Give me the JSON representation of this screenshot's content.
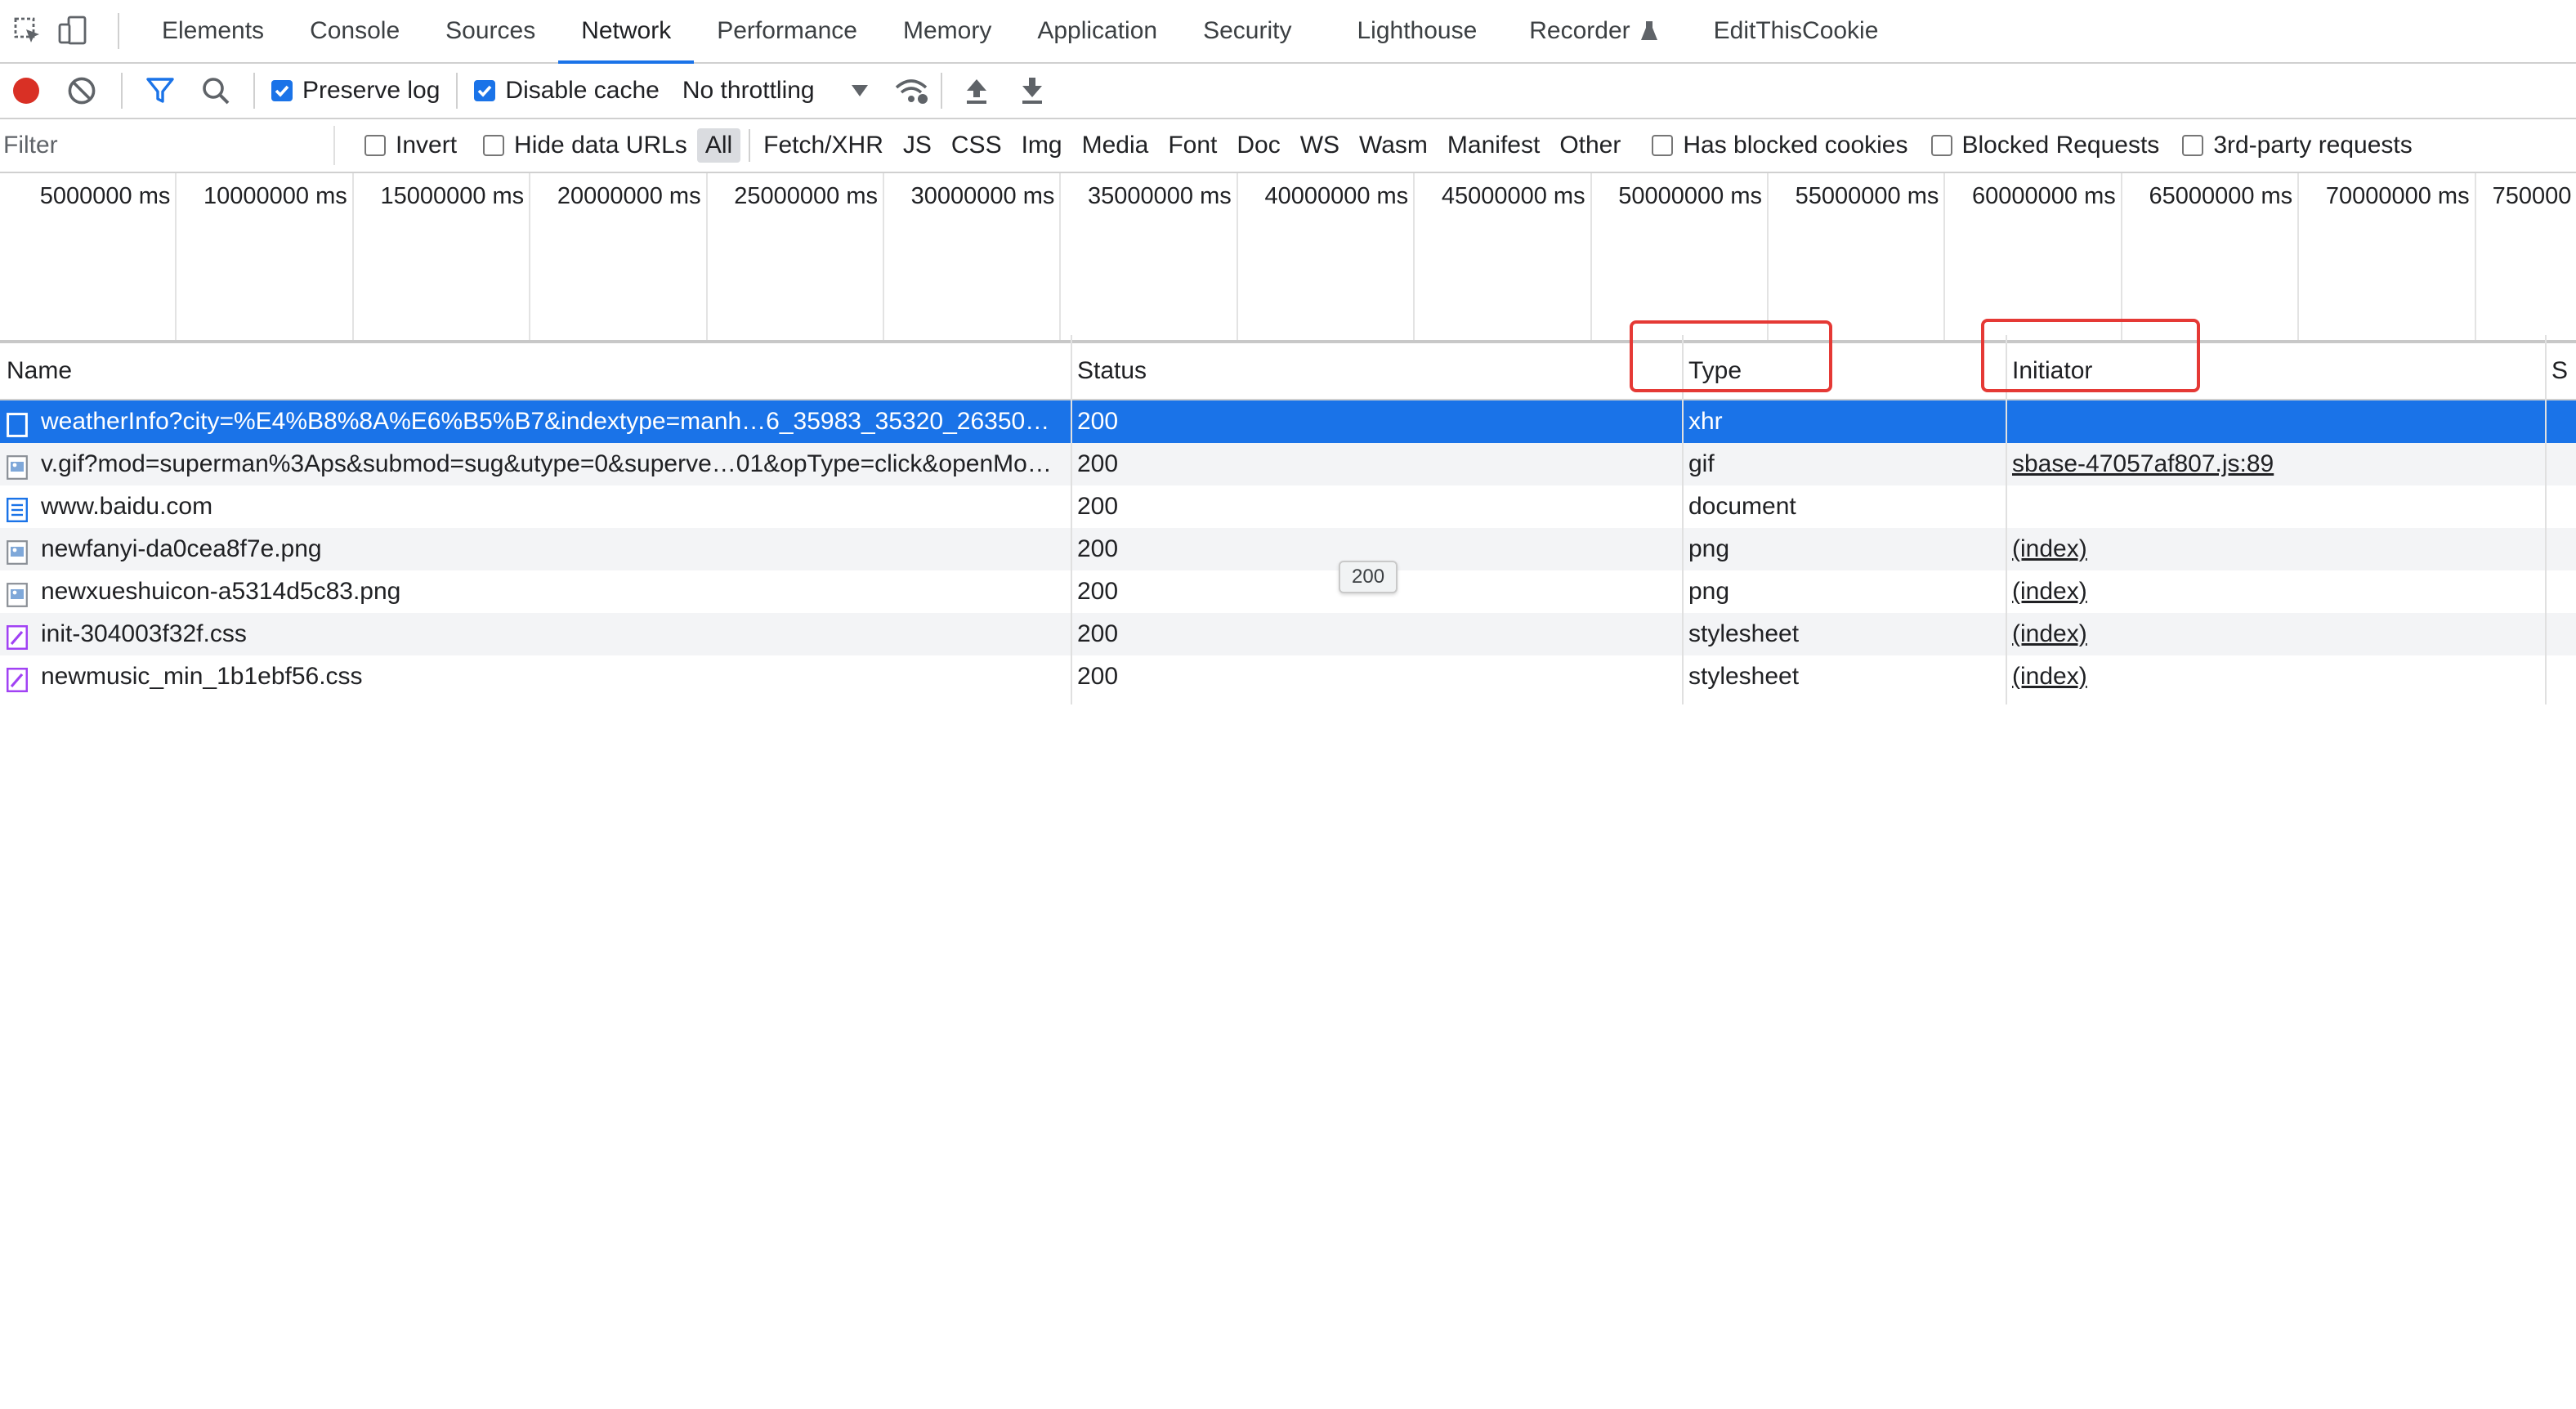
{
  "tabs": [
    "Elements",
    "Console",
    "Sources",
    "Network",
    "Performance",
    "Memory",
    "Application",
    "Security",
    "Lighthouse",
    "Recorder",
    "EditThisCookie"
  ],
  "active_tab": "Network",
  "toolbar": {
    "preserve_log": "Preserve log",
    "disable_cache": "Disable cache",
    "throttling": "No throttling"
  },
  "filter": {
    "placeholder": "Filter",
    "invert": "Invert",
    "hide_data_urls": "Hide data URLs",
    "types": [
      "All",
      "Fetch/XHR",
      "JS",
      "CSS",
      "Img",
      "Media",
      "Font",
      "Doc",
      "WS",
      "Wasm",
      "Manifest",
      "Other"
    ],
    "selected_type": "All",
    "has_blocked_cookies": "Has blocked cookies",
    "blocked_requests": "Blocked Requests",
    "third_party": "3rd-party requests"
  },
  "timeline_ticks": [
    "5000000 ms",
    "10000000 ms",
    "15000000 ms",
    "20000000 ms",
    "25000000 ms",
    "30000000 ms",
    "35000000 ms",
    "40000000 ms",
    "45000000 ms",
    "50000000 ms",
    "55000000 ms",
    "60000000 ms",
    "65000000 ms",
    "70000000 ms",
    "750000"
  ],
  "columns": {
    "name": "Name",
    "status": "Status",
    "type": "Type",
    "initiator": "Initiator",
    "size_partial": "S"
  },
  "rows": [
    {
      "name": "weatherInfo?city=%E4%B8%8A%E6%B5%B7&indextype=manh…6_35983_35320_26350…",
      "status": "200",
      "type": "xhr",
      "initiator": "",
      "icon": "xhr-icon"
    },
    {
      "name": "v.gif?mod=superman%3Aps&submod=sug&utype=0&superve…01&opType=click&openMo…",
      "status": "200",
      "type": "gif",
      "initiator": "sbase-47057af807.js:89",
      "icon": "image-icon"
    },
    {
      "name": "www.baidu.com",
      "status": "200",
      "type": "document",
      "initiator": "",
      "icon": "document-icon"
    },
    {
      "name": "newfanyi-da0cea8f7e.png",
      "status": "200",
      "type": "png",
      "initiator": "(index)",
      "icon": "image-icon"
    },
    {
      "name": "newxueshuicon-a5314d5c83.png",
      "status": "200",
      "type": "png",
      "initiator": "(index)",
      "icon": "image-icon"
    },
    {
      "name": "init-304003f32f.css",
      "status": "200",
      "type": "stylesheet",
      "initiator": "(index)",
      "icon": "stylesheet-icon"
    },
    {
      "name": "newmusic_min_1b1ebf56.css",
      "status": "200",
      "type": "stylesheet",
      "initiator": "(index)",
      "icon": "stylesheet-icon"
    }
  ],
  "tooltip": "200",
  "colors": {
    "accent": "#1a73e8",
    "record": "#d93025",
    "callout": "#e53935",
    "selected_row": "#1a73e8"
  }
}
